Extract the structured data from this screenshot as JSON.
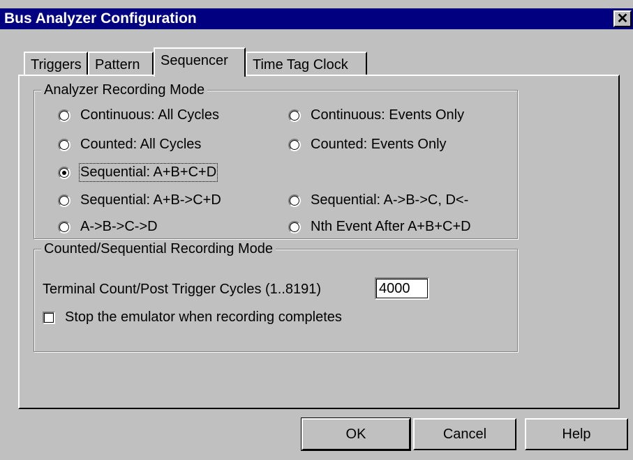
{
  "window": {
    "title": "Bus Analyzer Configuration",
    "close_glyph": "✕"
  },
  "tabs": [
    {
      "label": "Triggers"
    },
    {
      "label": "Pattern"
    },
    {
      "label": "Sequencer",
      "active": true
    },
    {
      "label": "Time Tag Clock"
    }
  ],
  "recording_mode": {
    "label": "Analyzer Recording Mode",
    "options": [
      {
        "label": "Continuous: All Cycles",
        "selected": false
      },
      {
        "label": "Continuous: Events Only",
        "selected": false
      },
      {
        "label": "Counted: All Cycles",
        "selected": false
      },
      {
        "label": "Counted: Events Only",
        "selected": false
      },
      {
        "label": "Sequential: A+B+C+D",
        "selected": true
      },
      {
        "label": "Sequential: A+B->C+D",
        "selected": false
      },
      {
        "label": "Sequential: A->B->C, D<-",
        "selected": false
      },
      {
        "label": "A->B->C->D",
        "selected": false
      },
      {
        "label": "Nth Event After A+B+C+D",
        "selected": false
      }
    ]
  },
  "counted_mode": {
    "label": "Counted/Sequential Recording Mode",
    "terminal_count_label": "Terminal Count/Post Trigger Cycles (1..8191)",
    "terminal_count_value": "4000",
    "stop_emulator_label": "Stop the emulator when recording completes",
    "stop_emulator_checked": false
  },
  "buttons": {
    "ok": "OK",
    "cancel": "Cancel",
    "help": "Help"
  },
  "colors": {
    "face": "#c0c0c0",
    "titlebar": "#000080",
    "highlight": "#ffffff",
    "shadow": "#808080"
  }
}
